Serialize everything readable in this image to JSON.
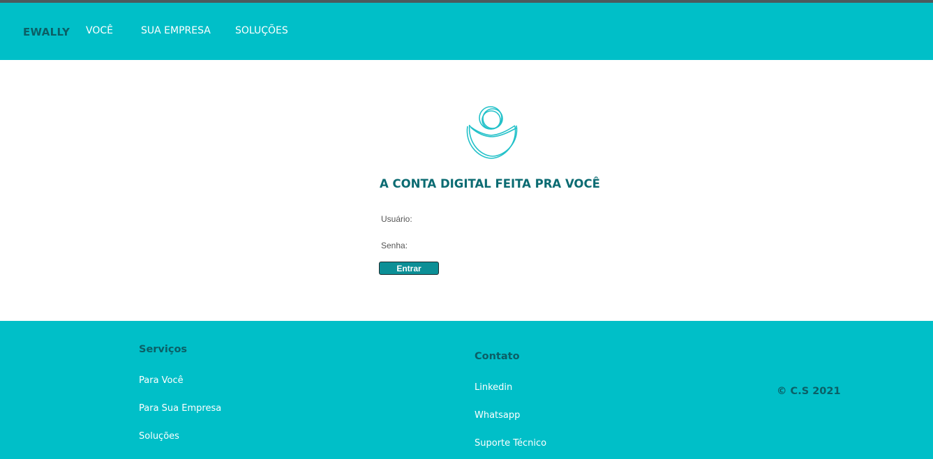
{
  "header": {
    "brand": "EWALLY",
    "nav": [
      "VOCÊ",
      "SUA EMPRESA",
      "SOLUÇÕES"
    ]
  },
  "main": {
    "logo_icon": "person-hug-icon",
    "headline": "A CONTA DIGITAL FEITA PRA VOCÊ",
    "username_label": "Usuário:",
    "username_value": "",
    "password_label": "Senha:",
    "password_value": "",
    "submit_label": "Entrar"
  },
  "footer": {
    "servicos": {
      "heading": "Serviços",
      "links": [
        "Para Você",
        "Para Sua Empresa",
        "Soluções"
      ]
    },
    "contato": {
      "heading": "Contato",
      "links": [
        "Linkedin",
        "Whatsapp",
        "Suporte Técnico"
      ]
    },
    "copyright": "© C.S 2021"
  },
  "colors": {
    "brand_teal": "#00bfc8",
    "dark_teal": "#0b5f66",
    "button": "#0c8f96"
  }
}
